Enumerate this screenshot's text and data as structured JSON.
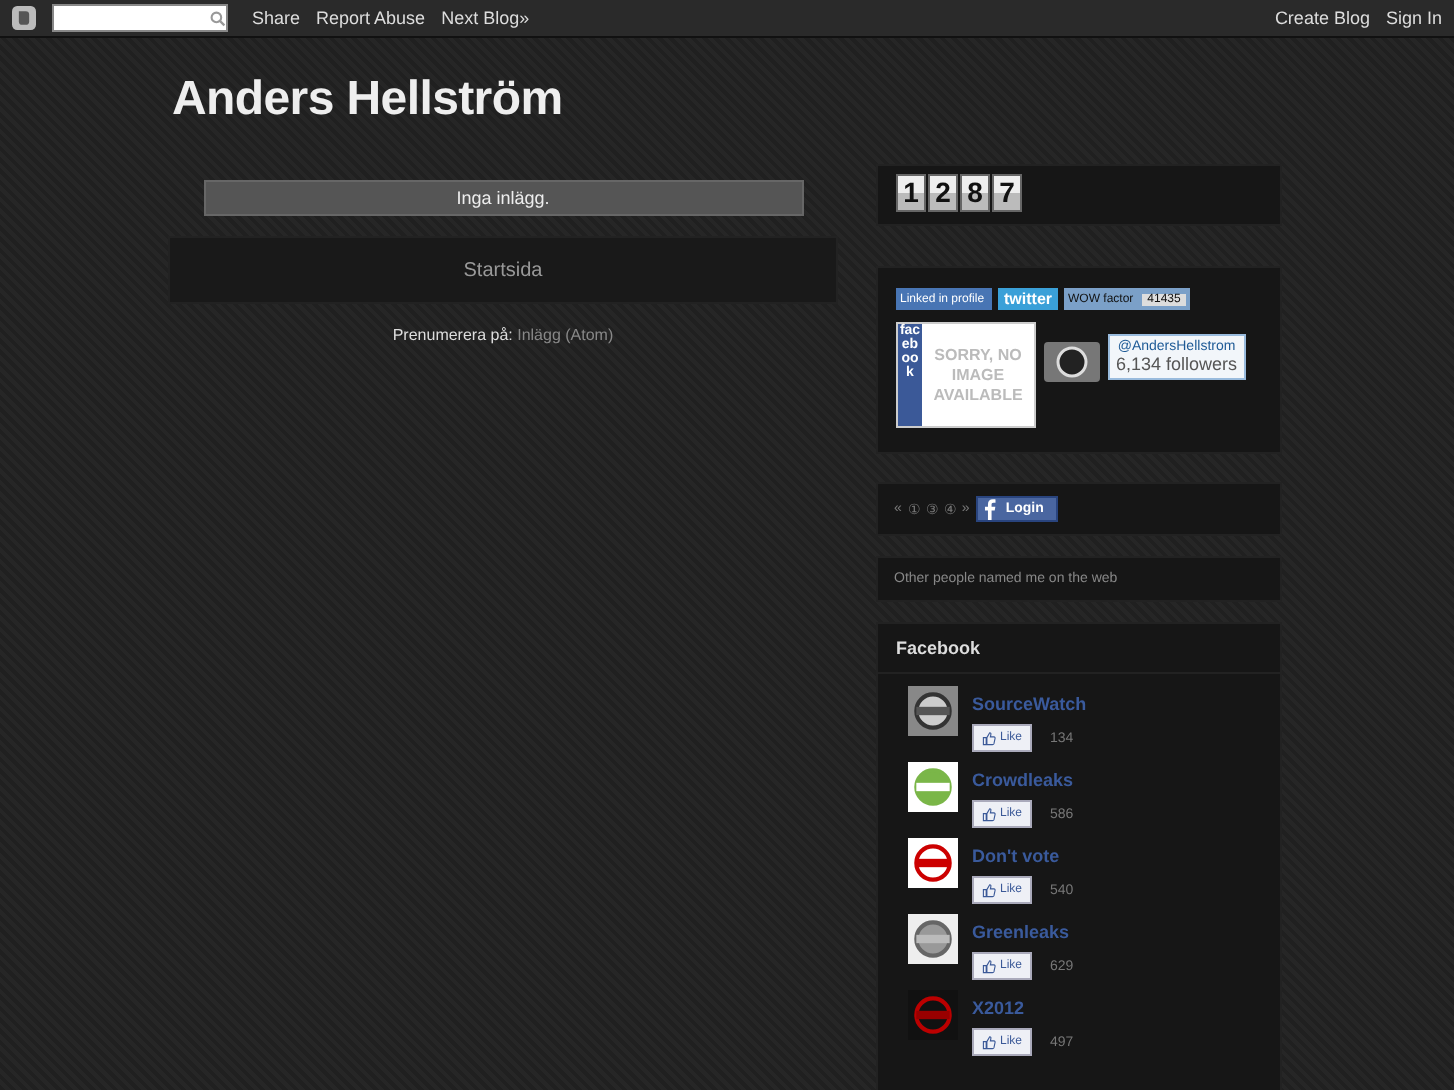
{
  "navbar": {
    "links": [
      "Share",
      "Report Abuse",
      "Next Blog»"
    ],
    "right_links": [
      "Create Blog",
      "Sign In"
    ]
  },
  "blog_title": "Anders Hellström",
  "main": {
    "notice": "Inga inlägg.",
    "home_link": "Startsida",
    "subscribe_label": "Prenumerera på:",
    "subscribe_link": "Inlägg (Atom)"
  },
  "sidebar": {
    "counter": [
      "1",
      "2",
      "8",
      "7"
    ],
    "badges": {
      "linkedin": "Linked in profile",
      "twitter": "twitter",
      "wow_label": "WOW factor",
      "wow_value": "41435",
      "facebook": "facebook",
      "no_image": "SORRY, NO IMAGE AVAILABLE",
      "handle": "@AndersHellstrom",
      "followers": "6,134 followers"
    },
    "pager": [
      "«",
      "①",
      "③",
      "④",
      "»"
    ],
    "login": "Login",
    "named_text": "Other people named me on the web",
    "facebook": {
      "title": "Facebook",
      "pages": [
        {
          "name": "SourceWatch",
          "count": "134",
          "like": "Like"
        },
        {
          "name": "Crowdleaks",
          "count": "586",
          "like": "Like"
        },
        {
          "name": "Don't vote",
          "count": "540",
          "like": "Like"
        },
        {
          "name": "Greenleaks",
          "count": "629",
          "like": "Like"
        },
        {
          "name": "X2012",
          "count": "497",
          "like": "Like"
        }
      ]
    }
  }
}
